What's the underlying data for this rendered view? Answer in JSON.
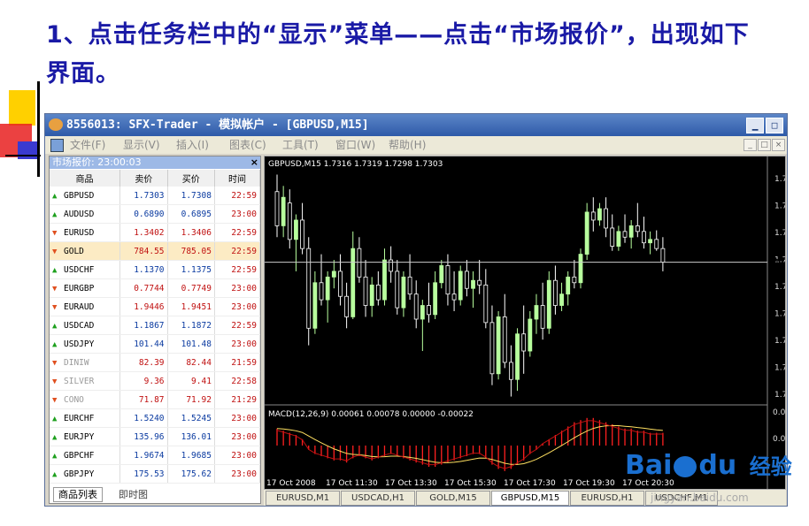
{
  "heading": {
    "line1": "1、点击任务栏中的“显示”菜单——点击“市场报价”，出现如下",
    "line2": "界面。"
  },
  "window": {
    "title": "8556013: SFX-Trader - 模拟帐户 - [GBPUSD,M15]",
    "min_label": "▁",
    "max_label": "□",
    "doc_min": "_",
    "doc_max": "□",
    "doc_close": "×"
  },
  "menu": [
    "文件(F)",
    "显示(V)",
    "插入(I)",
    "图表(C)",
    "工具(T)",
    "窗口(W)",
    "帮助(H)"
  ],
  "market_watch": {
    "title": "市场报价: 23:00:03",
    "close": "×",
    "headers": [
      "商品",
      "卖价",
      "买价",
      "时间"
    ],
    "rows": [
      {
        "symbol": "GBPUSD",
        "bid": "1.7303",
        "ask": "1.7308",
        "time": "22:59",
        "dir": "up"
      },
      {
        "symbol": "AUDUSD",
        "bid": "0.6890",
        "ask": "0.6895",
        "time": "23:00",
        "dir": "up"
      },
      {
        "symbol": "EURUSD",
        "bid": "1.3402",
        "ask": "1.3406",
        "time": "22:59",
        "dir": "down"
      },
      {
        "symbol": "GOLD",
        "bid": "784.55",
        "ask": "785.05",
        "time": "22:59",
        "dir": "down"
      },
      {
        "symbol": "USDCHF",
        "bid": "1.1370",
        "ask": "1.1375",
        "time": "22:59",
        "dir": "up"
      },
      {
        "symbol": "EURGBP",
        "bid": "0.7744",
        "ask": "0.7749",
        "time": "23:00",
        "dir": "down"
      },
      {
        "symbol": "EURAUD",
        "bid": "1.9446",
        "ask": "1.9451",
        "time": "23:00",
        "dir": "down"
      },
      {
        "symbol": "USDCAD",
        "bid": "1.1867",
        "ask": "1.1872",
        "time": "22:59",
        "dir": "up"
      },
      {
        "symbol": "USDJPY",
        "bid": "101.44",
        "ask": "101.48",
        "time": "23:00",
        "dir": "up"
      },
      {
        "symbol": "DINIW",
        "bid": "82.39",
        "ask": "82.44",
        "time": "21:59",
        "dir": "down"
      },
      {
        "symbol": "SILVER",
        "bid": "9.36",
        "ask": "9.41",
        "time": "22:58",
        "dir": "down"
      },
      {
        "symbol": "CONO",
        "bid": "71.87",
        "ask": "71.92",
        "time": "21:29",
        "dir": "down"
      },
      {
        "symbol": "EURCHF",
        "bid": "1.5240",
        "ask": "1.5245",
        "time": "23:00",
        "dir": "up"
      },
      {
        "symbol": "EURJPY",
        "bid": "135.96",
        "ask": "136.01",
        "time": "23:00",
        "dir": "up"
      },
      {
        "symbol": "GBPCHF",
        "bid": "1.9674",
        "ask": "1.9685",
        "time": "23:00",
        "dir": "up"
      },
      {
        "symbol": "GBPJPY",
        "bid": "175.53",
        "ask": "175.62",
        "time": "23:00",
        "dir": "up"
      }
    ],
    "tabs": [
      "商品列表",
      "即时图"
    ]
  },
  "chart": {
    "header": "GBPUSD,M15  1.7316 1.7319 1.7298 1.7303",
    "macd_header": "MACD(12,26,9) 0.00061 0.00078 0.00000 -0.00022",
    "price_ticks": [
      "1.7",
      "1.7",
      "1.7",
      "1.7",
      "1.7",
      "1.7",
      "1.7",
      "1.7",
      "1.7"
    ],
    "current_price_label": "1.7",
    "macd_ticks": [
      "0.00",
      "0.00",
      "-0.0"
    ],
    "time_labels": [
      "17 Oct 2008",
      "17 Oct 11:30",
      "17 Oct 13:30",
      "17 Oct 15:30",
      "17 Oct 17:30",
      "17 Oct 19:30",
      "17 Oct 20:30"
    ],
    "candles": [
      [
        1.737,
        1.7385,
        1.733,
        1.734
      ],
      [
        1.734,
        1.7375,
        1.733,
        1.7365
      ],
      [
        1.736,
        1.7372,
        1.732,
        1.7328
      ],
      [
        1.7328,
        1.735,
        1.73,
        1.7345
      ],
      [
        1.7345,
        1.736,
        1.7315,
        1.732
      ],
      [
        1.732,
        1.733,
        1.7235,
        1.725
      ],
      [
        1.725,
        1.73,
        1.7245,
        1.729
      ],
      [
        1.729,
        1.7315,
        1.727,
        1.7275
      ],
      [
        1.7275,
        1.73,
        1.7255,
        1.7295
      ],
      [
        1.7295,
        1.731,
        1.7285,
        1.73
      ],
      [
        1.73,
        1.7315,
        1.727,
        1.7278
      ],
      [
        1.7278,
        1.729,
        1.725,
        1.726
      ],
      [
        1.726,
        1.7335,
        1.7258,
        1.732
      ],
      [
        1.732,
        1.733,
        1.729,
        1.7295
      ],
      [
        1.7295,
        1.731,
        1.726,
        1.727
      ],
      [
        1.727,
        1.7295,
        1.726,
        1.7288
      ],
      [
        1.7288,
        1.73,
        1.727,
        1.7275
      ],
      [
        1.7275,
        1.732,
        1.727,
        1.731
      ],
      [
        1.731,
        1.7322,
        1.729,
        1.73
      ],
      [
        1.73,
        1.731,
        1.7262,
        1.7268
      ],
      [
        1.7268,
        1.73,
        1.726,
        1.7295
      ],
      [
        1.7295,
        1.7315,
        1.7275,
        1.728
      ],
      [
        1.728,
        1.7292,
        1.725,
        1.7258
      ],
      [
        1.7258,
        1.7275,
        1.723,
        1.727
      ],
      [
        1.727,
        1.729,
        1.7255,
        1.7262
      ],
      [
        1.7262,
        1.73,
        1.7258,
        1.729
      ],
      [
        1.729,
        1.731,
        1.7285,
        1.7305
      ],
      [
        1.7305,
        1.7315,
        1.727,
        1.728
      ],
      [
        1.728,
        1.73,
        1.7265,
        1.7275
      ],
      [
        1.7275,
        1.7305,
        1.727,
        1.73
      ],
      [
        1.73,
        1.731,
        1.7278,
        1.7285
      ],
      [
        1.7285,
        1.73,
        1.7268,
        1.7292
      ],
      [
        1.7292,
        1.731,
        1.728,
        1.7288
      ],
      [
        1.7288,
        1.7302,
        1.725,
        1.7255
      ],
      [
        1.7255,
        1.727,
        1.72,
        1.721
      ],
      [
        1.721,
        1.7265,
        1.7205,
        1.726
      ],
      [
        1.726,
        1.728,
        1.7215,
        1.722
      ],
      [
        1.722,
        1.7235,
        1.719,
        1.7205
      ],
      [
        1.7205,
        1.725,
        1.7195,
        1.7245
      ],
      [
        1.7245,
        1.727,
        1.721,
        1.723
      ],
      [
        1.723,
        1.7265,
        1.7225,
        1.7258
      ],
      [
        1.7258,
        1.728,
        1.7245,
        1.727
      ],
      [
        1.727,
        1.729,
        1.724,
        1.725
      ],
      [
        1.725,
        1.73,
        1.7245,
        1.7292
      ],
      [
        1.7292,
        1.7305,
        1.7262,
        1.727
      ],
      [
        1.727,
        1.729,
        1.7265,
        1.728
      ],
      [
        1.728,
        1.73,
        1.727,
        1.7295
      ],
      [
        1.7295,
        1.731,
        1.7285,
        1.729
      ],
      [
        1.729,
        1.732,
        1.7285,
        1.7315
      ],
      [
        1.7315,
        1.736,
        1.731,
        1.7352
      ],
      [
        1.7352,
        1.7365,
        1.7335,
        1.7345
      ],
      [
        1.7345,
        1.736,
        1.734,
        1.7355
      ],
      [
        1.7355,
        1.7365,
        1.733,
        1.7338
      ],
      [
        1.7338,
        1.735,
        1.7318,
        1.7322
      ],
      [
        1.7322,
        1.734,
        1.7318,
        1.7335
      ],
      [
        1.7335,
        1.735,
        1.7325,
        1.733
      ],
      [
        1.733,
        1.7345,
        1.732,
        1.734
      ],
      [
        1.734,
        1.736,
        1.733,
        1.7335
      ],
      [
        1.7335,
        1.7348,
        1.732,
        1.7325
      ],
      [
        1.7325,
        1.7335,
        1.7315,
        1.7328
      ],
      [
        1.7328,
        1.7336,
        1.7318,
        1.732
      ],
      [
        1.732,
        1.733,
        1.73,
        1.7308
      ]
    ],
    "macd_hist": [
      0.0008,
      0.0007,
      0.0006,
      0.0005,
      0.0003,
      -0.0002,
      -0.0004,
      -0.0005,
      -0.0006,
      -0.0007,
      -0.0007,
      -0.0008,
      -0.0006,
      -0.0005,
      -0.0006,
      -0.0007,
      -0.0006,
      -0.0005,
      -0.0004,
      -0.0005,
      -0.0006,
      -0.0007,
      -0.0008,
      -0.0009,
      -0.001,
      -0.001,
      -0.0009,
      -0.0008,
      -0.0007,
      -0.0006,
      -0.0005,
      -0.0004,
      -0.0004,
      -0.0006,
      -0.0009,
      -0.0011,
      -0.0012,
      -0.0011,
      -0.0009,
      -0.0007,
      -0.0004,
      -0.0002,
      0.0001,
      0.0003,
      0.0005,
      0.0007,
      0.0009,
      0.0011,
      0.0012,
      0.0013,
      0.0013,
      0.0012,
      0.0011,
      0.001,
      0.0009,
      0.0008,
      0.0008,
      0.0007,
      0.0007,
      0.0006,
      0.0006,
      0.0006
    ]
  },
  "bottom_tabs": [
    "EURUSD,M1",
    "USDCAD,H1",
    "GOLD,M15",
    "GBPUSD,M15",
    "EURUSD,H1",
    "USDCHF,M1"
  ],
  "bottom_tab_active": 3,
  "watermark": {
    "brand": "Bai",
    "brand2": "du",
    "sub": "经验",
    "url": "jingyan.baidu.com"
  },
  "colors": {
    "heading": "#1a1aa6",
    "bull": "#b8ff9e",
    "bear": "#ffffff",
    "macd_hist": "#ff2020",
    "signal": "#ffe060"
  }
}
